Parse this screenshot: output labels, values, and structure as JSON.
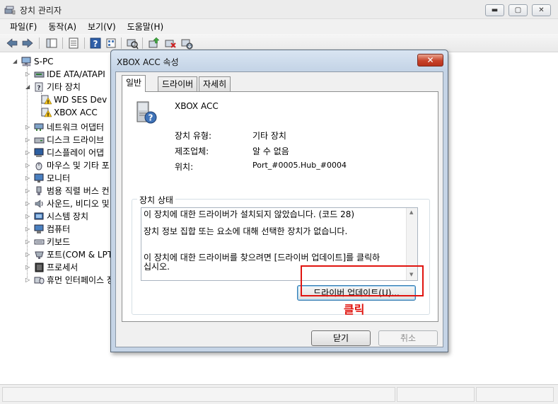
{
  "window": {
    "title": "장치 관리자",
    "controls": {
      "minimize": "▬",
      "maximize": "▢",
      "close": "✕"
    }
  },
  "menu": [
    "파일(F)",
    "동작(A)",
    "보기(V)",
    "도움말(H)"
  ],
  "tree": {
    "root": "S-PC",
    "items": [
      {
        "label": "IDE ATA/ATAPI",
        "icon": "ide-icon",
        "expanded": false
      },
      {
        "label": "기타 장치",
        "icon": "unknown-device-icon",
        "expanded": true,
        "children": [
          {
            "label": "WD SES Dev",
            "icon": "warning-device-icon"
          },
          {
            "label": "XBOX ACC",
            "icon": "warning-device-icon"
          }
        ]
      },
      {
        "label": "네트워크 어댑터",
        "icon": "network-adapter-icon",
        "expanded": false
      },
      {
        "label": "디스크 드라이브",
        "icon": "disk-drive-icon",
        "expanded": false
      },
      {
        "label": "디스플레이 어댑",
        "icon": "display-adapter-icon",
        "expanded": false
      },
      {
        "label": "마우스 및 기타 포",
        "icon": "mouse-icon",
        "expanded": false
      },
      {
        "label": "모니터",
        "icon": "monitor-icon",
        "expanded": false
      },
      {
        "label": "범용 직렬 버스 컨",
        "icon": "usb-icon",
        "expanded": false
      },
      {
        "label": "사운드, 비디오 및",
        "icon": "sound-icon",
        "expanded": false
      },
      {
        "label": "시스템 장치",
        "icon": "system-device-icon",
        "expanded": false
      },
      {
        "label": "컴퓨터",
        "icon": "computer-icon",
        "expanded": false
      },
      {
        "label": "키보드",
        "icon": "keyboard-icon",
        "expanded": false
      },
      {
        "label": "포트(COM & LPT)",
        "icon": "port-icon",
        "expanded": false
      },
      {
        "label": "프로세서",
        "icon": "processor-icon",
        "expanded": false
      },
      {
        "label": "휴먼 인터페이스 장",
        "icon": "hid-icon",
        "expanded": false
      }
    ]
  },
  "dialog": {
    "title": "XBOX ACC 속성",
    "close": "✕",
    "tabs": [
      "일반",
      "드라이버",
      "자세히"
    ],
    "active_tab": 0,
    "device_name": "XBOX ACC",
    "properties": [
      {
        "label": "장치 유형:",
        "value": "기타 장치"
      },
      {
        "label": "제조업체:",
        "value": "알 수 없음"
      },
      {
        "label": "위치:",
        "value": "Port_#0005.Hub_#0004"
      }
    ],
    "status_group_label": "장치 상태",
    "status_lines": [
      "이 장치에 대한 드라이버가 설치되지 않았습니다. (코드 28)",
      "장치 정보 집합 또는 요소에 대해 선택한 장치가 없습니다.",
      "이 장치에 대한 드라이버를 찾으려면 [드라이버 업데이트]를 클릭하",
      "십시오."
    ],
    "update_driver_button": "드라이버 업데이트(U)...",
    "ok_button": "닫기",
    "cancel_button": "취소"
  },
  "annotation": {
    "text": "클릭",
    "color": "#e0140f"
  }
}
